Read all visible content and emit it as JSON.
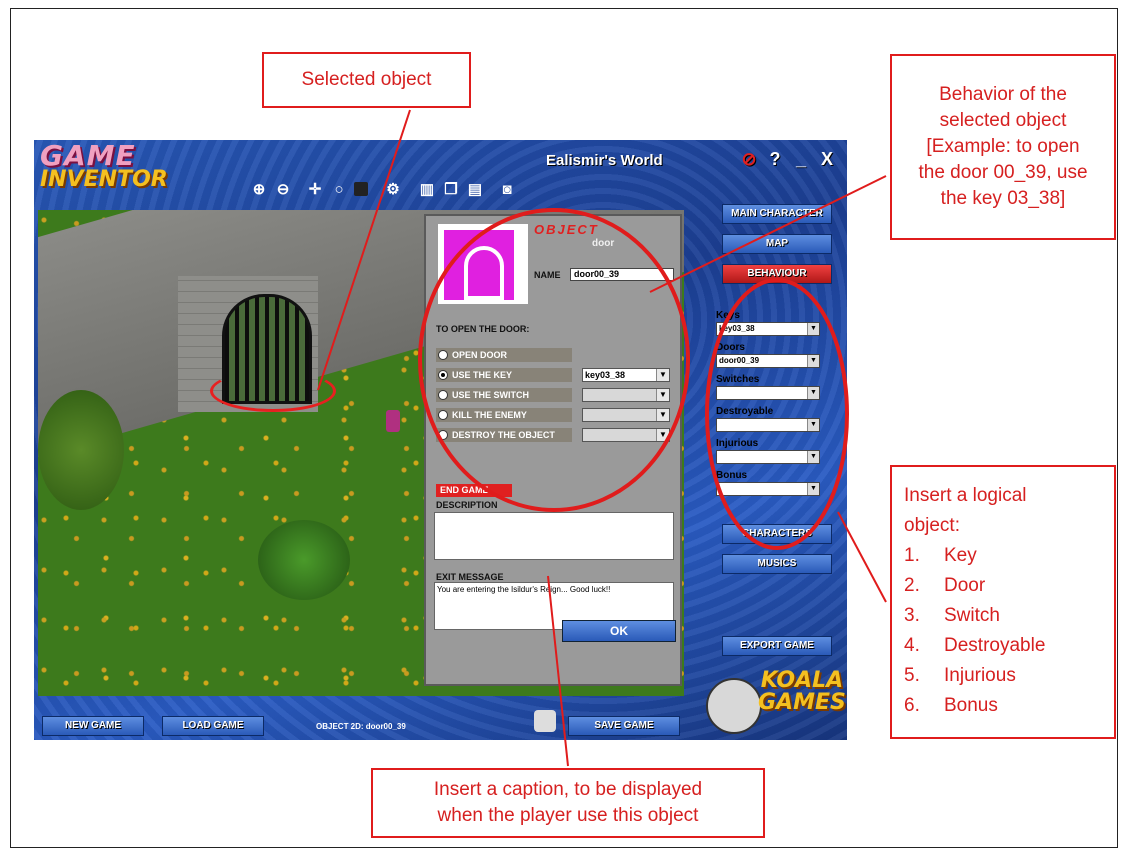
{
  "callouts": {
    "selected": "Selected object",
    "behavior": [
      "Behavior of the",
      "selected object",
      "[Example: to open",
      "the door 00_39, use",
      "the key 03_38]"
    ],
    "caption": [
      "Insert a caption, to be displayed",
      "when the player use this object"
    ],
    "logical_title": [
      "Insert a logical",
      "object:"
    ],
    "logical_items": [
      {
        "num": "1.",
        "label": "Key"
      },
      {
        "num": "2.",
        "label": "Door"
      },
      {
        "num": "3.",
        "label": "Switch"
      },
      {
        "num": "4.",
        "label": "Destroyable"
      },
      {
        "num": "5.",
        "label": "Injurious"
      },
      {
        "num": "6.",
        "label": "Bonus"
      }
    ]
  },
  "app": {
    "logo_line1": "GAME",
    "logo_line2": "INVENTOR",
    "title": "Ealismir's World",
    "window_buttons": [
      "no-entry-icon",
      "help-icon",
      "minimize-icon",
      "close-icon"
    ],
    "toolbar_icons": [
      "zoom-in-icon",
      "zoom-out-icon",
      "move-icon",
      "rotate-icon",
      "square-icon",
      "gear-icon",
      "trash-icon",
      "copy-icon",
      "paste-icon",
      "camera-icon"
    ],
    "panel": {
      "title": "OBJECT",
      "subtitle": "door",
      "name_label": "NAME",
      "name_value": "door00_39",
      "open_label": "TO OPEN THE DOOR:",
      "options": [
        {
          "label": "OPEN DOOR",
          "selected": false
        },
        {
          "label": "USE THE KEY",
          "selected": true,
          "value": "key03_38"
        },
        {
          "label": "USE THE SWITCH",
          "selected": false,
          "value": ""
        },
        {
          "label": "KILL THE ENEMY",
          "selected": false,
          "value": ""
        },
        {
          "label": "DESTROY THE OBJECT",
          "selected": false,
          "value": ""
        }
      ],
      "end_game": "END GAME",
      "description_label": "DESCRIPTION",
      "description_value": "",
      "exit_label": "EXIT MESSAGE",
      "exit_value": "You are entering the Isildur's Reign... Good luck!!",
      "ok": "OK"
    },
    "right": {
      "main_character": "MAIN CHARACTER",
      "map": "MAP",
      "behaviour": "BEHAVIOUR",
      "lists": [
        {
          "label": "Keys",
          "value": "key03_38"
        },
        {
          "label": "Doors",
          "value": "door00_39"
        },
        {
          "label": "Switches",
          "value": ""
        },
        {
          "label": "Destroyable",
          "value": ""
        },
        {
          "label": "Injurious",
          "value": ""
        },
        {
          "label": "Bonus",
          "value": ""
        }
      ],
      "characters": "CHARACTERS",
      "musics": "MUSICS",
      "export": "EXPORT GAME"
    },
    "bottom": {
      "new_game": "NEW GAME",
      "load_game": "LOAD GAME",
      "status": "OBJECT 2D: door00_39",
      "save_game": "SAVE GAME"
    },
    "brand_line1": "KOALA",
    "brand_line2": "GAMES"
  },
  "colors": {
    "callout": "#e01c1c",
    "accent_red": "#e02020",
    "app_blue": "#2858b8"
  }
}
